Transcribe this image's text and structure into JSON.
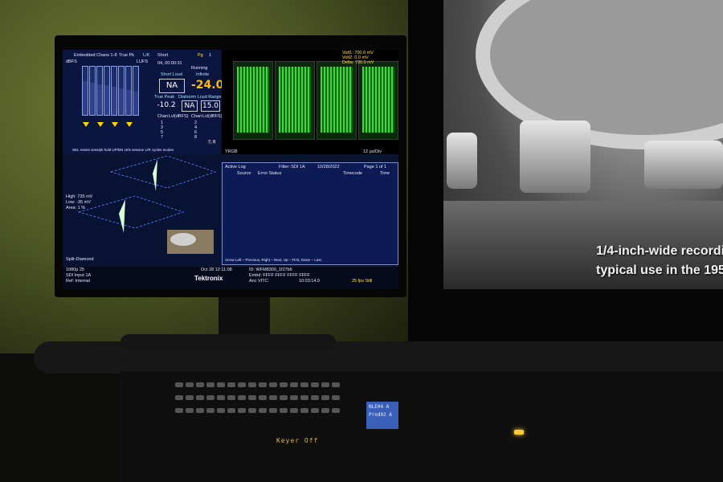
{
  "waveform_monitor": {
    "brand": "Tektronix",
    "audio": {
      "title": "Embedded Chans 1-8",
      "true_pk": "True Pk",
      "lk": "L/K",
      "short_label": "Short",
      "pg": "Pg",
      "pg_num": "1",
      "dbfs": "dBFS",
      "lufs": "LUFS",
      "time": "04, 00:00:31",
      "running": "Running",
      "short_loud": "Short Loud",
      "infinite": "Infinite",
      "short_loud_val": "NA",
      "infinite_val": "-24.0",
      "true_peak_label": "True Peak",
      "dialnorm_label": "Dialnorm Loud Range",
      "true_peak_val": "-10.2",
      "dialnorm_val": "NA",
      "loud_range_val": "15.0",
      "chan_header_1": "Chan",
      "lvl_header_1": "Lvl(dBFS)",
      "chan_header_2": "Chan",
      "lvl_header_2": "Lvl(dBFS)",
      "chan_rows": [
        "1",
        "3",
        "5",
        "7"
      ],
      "chan_rows_2": [
        "2",
        "4",
        "6",
        "8"
      ],
      "footer": "SEL resets sess/pk hold UP/DN ctrls session L/R cycles modes",
      "badge": "7, 8"
    },
    "waveform": {
      "volt1": "Volt1: 700.0 mV",
      "volt2": "Volt2: 0.0 mV",
      "delta": "Delta: 700.0 mV",
      "mode": "YRGB",
      "scale": "12 µs/Div"
    },
    "diamond": {
      "high": "High: 735 mV",
      "low": "Low: -35 mV",
      "area": "Area: 1 %",
      "label": "Split-Diamond"
    },
    "log": {
      "title": "Active Log",
      "filter": "Filter: SDI 1A",
      "date": "10/28/2022",
      "page": "Page 1 of 1",
      "col_source": "Source",
      "col_error": "Error Status",
      "col_timecode": "Timecode",
      "col_time": "Time",
      "nav": "Arrow Left – Previous, Right – Next, Up – First, Down – Last."
    },
    "status": {
      "format": "1080p 25",
      "input": "SDI Input 1A",
      "ref": "Ref: Internal",
      "date": "Oct 28 12:11:08",
      "id": "ID: WFM8300_1f27b6",
      "embd": "Embd: FFFF FFFF FFFF FFFF",
      "anc": "Anc VITC:",
      "timecode": "10:03:14.0",
      "fps": "25 fps Still"
    }
  },
  "router_panel": {
    "lcd_line1": "NLE04 A",
    "lcd_line2": "Prod02 A",
    "keyer": "Keyer Off"
  },
  "tv": {
    "caption_line1": "1/4-inch-wide recordi",
    "caption_line2": "typical use in the 195"
  }
}
